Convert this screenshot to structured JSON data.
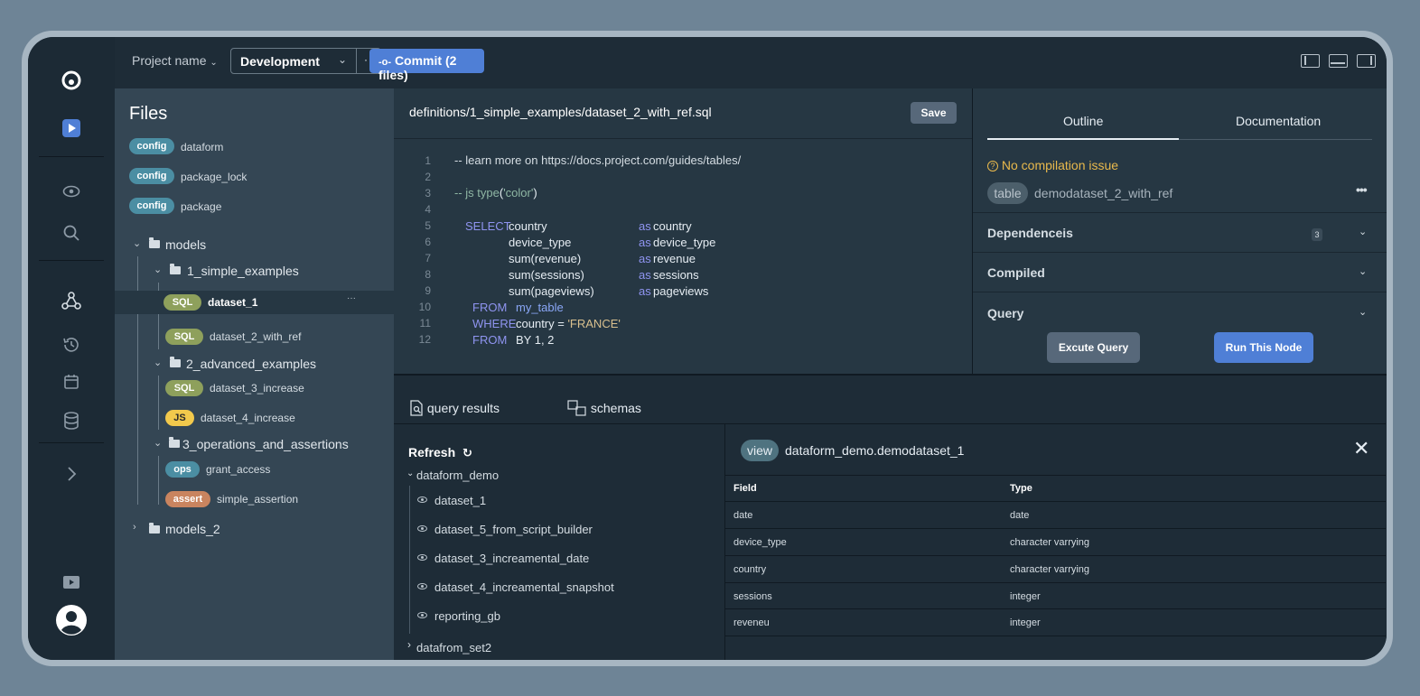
{
  "topbar": {
    "project_name": "Project name",
    "branch": "Development",
    "branch_more": "··",
    "commit_label": "Commit (2 files)"
  },
  "files": {
    "title": "Files",
    "configs": [
      {
        "tag": "config",
        "name": "dataform"
      },
      {
        "tag": "config",
        "name": "package_lock"
      },
      {
        "tag": "config",
        "name": "package"
      }
    ],
    "models_folder": "models",
    "simple_folder": "1_simple_examples",
    "simple_files": [
      {
        "tag": "SQL",
        "name": "dataset_1"
      },
      {
        "tag": "SQL",
        "name": "dataset_2_with_ref"
      }
    ],
    "advanced_folder": "2_advanced_examples",
    "advanced_files": [
      {
        "tag": "SQL",
        "name": "dataset_3_increase"
      },
      {
        "tag": "JS",
        "name": "dataset_4_increase"
      }
    ],
    "ops_folder": "3_operations_and_assertions",
    "ops_files": [
      {
        "tag": "ops",
        "name": "grant_access"
      },
      {
        "tag": "assert",
        "name": "simple_assertion"
      }
    ],
    "models2_folder": "models_2",
    "row_more": "···"
  },
  "editor": {
    "path": "definitions/1_simple_examples/dataset_2_with_ref.sql",
    "save_label": "Save",
    "line_numbers": [
      "1",
      "2",
      "3",
      "4",
      "5",
      "6",
      "7",
      "8",
      "9",
      "10",
      "11",
      "12"
    ],
    "lines": {
      "l1": "-- learn more on https://docs.project.com/guides/tables/",
      "l3_a": "-- js ",
      "l3_b": "type",
      "l3_c": "(",
      "l3_d": "'color'",
      "l3_e": ")",
      "kw_select": "SELECT",
      "cols": [
        "country",
        "device_type",
        "sum(revenue)",
        "sum(sessions)",
        "sum(pageviews)"
      ],
      "as": "as",
      "aliases": [
        "country",
        "device_type",
        "revenue",
        "sessions",
        "pageviews"
      ],
      "kw_from": "FROM",
      "table": "my_table",
      "kw_where": "WHERE",
      "where_expr": "country = ",
      "where_val": "'FRANCE'",
      "kw_from2": "FROM",
      "by_expr": "BY 1, 2"
    }
  },
  "outline": {
    "tab_outline": "Outline",
    "tab_docs": "Documentation",
    "status": "No compilation issue",
    "node_type": "table",
    "node_name": "demodataset_2_with_ref",
    "node_more": "•••",
    "dependencies_label": "Dependenceis",
    "dependencies_count": "3",
    "compiled_label": "Compiled",
    "query_label": "Query",
    "execute_label": "Excute Query",
    "run_label": "Run This Node"
  },
  "bottom": {
    "tab_results": "query results",
    "tab_schemas": "schemas",
    "refresh_label": "Refresh",
    "schema1": "dataform_demo",
    "datasets": [
      "dataset_1",
      "dataset_5_from_script_builder",
      "dataset_3_increamental_date",
      "dataset_4_increamental_snapshot",
      "reporting_gb"
    ],
    "schema2": "datafrom_set2",
    "detail": {
      "type": "view",
      "name": "dataform_demo.demodataset_1",
      "col_field": "Field",
      "col_type": "Type",
      "rows": [
        {
          "field": "date",
          "type": "date"
        },
        {
          "field": "device_type",
          "type": "character varrying"
        },
        {
          "field": "country",
          "type": "character varrying"
        },
        {
          "field": "sessions",
          "type": "integer"
        },
        {
          "field": "reveneu",
          "type": "integer"
        }
      ]
    }
  },
  "colors": {
    "accent": "#4f7fd6",
    "warning": "#e9b94c",
    "config_tag": "#4b8ea3",
    "sql_tag": "#8ea05c",
    "js_tag": "#f2c94c",
    "assert_tag": "#c9845f"
  },
  "icons": [
    "logo-icon",
    "play-icon",
    "eye-icon",
    "search-icon",
    "graph-icon",
    "history-icon",
    "calendar-icon",
    "database-icon",
    "chevron-right-icon",
    "video-icon",
    "user-icon",
    "refresh-icon",
    "close-icon",
    "file-search-icon",
    "schema-icon"
  ]
}
